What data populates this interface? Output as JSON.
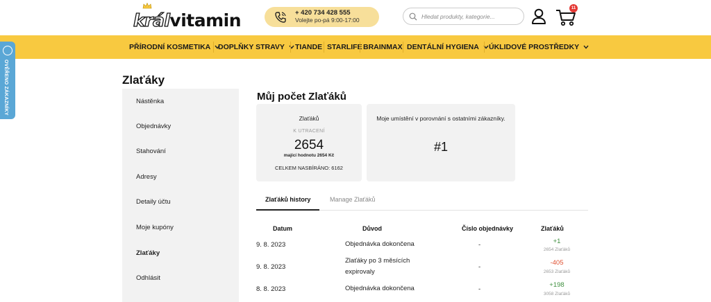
{
  "header": {
    "logo_part1": "král",
    "logo_part2": "vitamin",
    "phone": "+ 420 734 428 555",
    "hours": "Volejte po-pá 9:00-17:00",
    "search_placeholder": "Hledat produkty, kategorie...",
    "cart_count": "11",
    "icons": {
      "phone": "phone-icon",
      "search": "search-icon",
      "user": "user-icon",
      "cart": "cart-icon"
    }
  },
  "nav": {
    "items": [
      {
        "label": "PŘÍRODNÍ KOSMETIKA",
        "has_dropdown": true
      },
      {
        "label": "DOPLŇKY STRAVY",
        "has_dropdown": true
      },
      {
        "label": "TIANDE",
        "has_dropdown": false
      },
      {
        "label": "STARLIFE",
        "has_dropdown": false
      },
      {
        "label": "BRAINMAX",
        "has_dropdown": false
      },
      {
        "label": "DENTÁLNÍ HYGIENA",
        "has_dropdown": true
      },
      {
        "label": "ÚKLIDOVÉ PROSTŘEDKY",
        "has_dropdown": true
      }
    ]
  },
  "side_badge": {
    "label": "OVĚŘENO ZÁKAZNÍKY"
  },
  "page_title": "Zlaťáky",
  "sidebar": {
    "items": [
      {
        "label": "Nástěnka"
      },
      {
        "label": "Objednávky"
      },
      {
        "label": "Stahování"
      },
      {
        "label": "Adresy"
      },
      {
        "label": "Detaily účtu"
      },
      {
        "label": "Moje kupóny"
      },
      {
        "label": "Zlaťáky",
        "active": true
      },
      {
        "label": "Odhlásit"
      }
    ]
  },
  "main": {
    "title": "Můj počet Zlaťáků",
    "card1": {
      "heading": "Zlaťáků",
      "subheading": "K UTRACENÍ",
      "amount": "2654",
      "value_note": "mající hodnotu 2654 Kč",
      "total": "CELKEM NASBÍRÁNO: 6162"
    },
    "card2": {
      "heading": "Moje umístění v porovnání s ostatními zákazníky.",
      "rank": "#1"
    },
    "tabs": [
      {
        "label": "Zlaťáků history",
        "active": true
      },
      {
        "label": "Manage Zlaťáků",
        "active": false
      }
    ],
    "table": {
      "headers": [
        "Datum",
        "Důvod",
        "Číslo objednávky",
        "Zlaťáků"
      ],
      "rows": [
        {
          "date": "9. 8. 2023",
          "reason_lines": [
            "Objednávka dokončena"
          ],
          "order": "-",
          "points": "+1",
          "balance": "2654 Zlaťáků",
          "sign": "pos"
        },
        {
          "date": "9. 8. 2023",
          "reason_lines": [
            "Zlaťáky po 3 měsících",
            "expirovaly"
          ],
          "order": "-",
          "points": "-405",
          "balance": "2653 Zlaťáků",
          "sign": "neg"
        },
        {
          "date": "8. 8. 2023",
          "reason_lines": [
            "Objednávka dokončena"
          ],
          "order": "-",
          "points": "+198",
          "balance": "3058 Zlaťáků",
          "sign": "pos"
        }
      ]
    }
  },
  "colors": {
    "nav_bg": "#f8c940",
    "phone_pill": "#f7df9a",
    "badge_blue": "#5aa7d6",
    "positive": "#3f8f3f",
    "negative": "#e05030"
  }
}
